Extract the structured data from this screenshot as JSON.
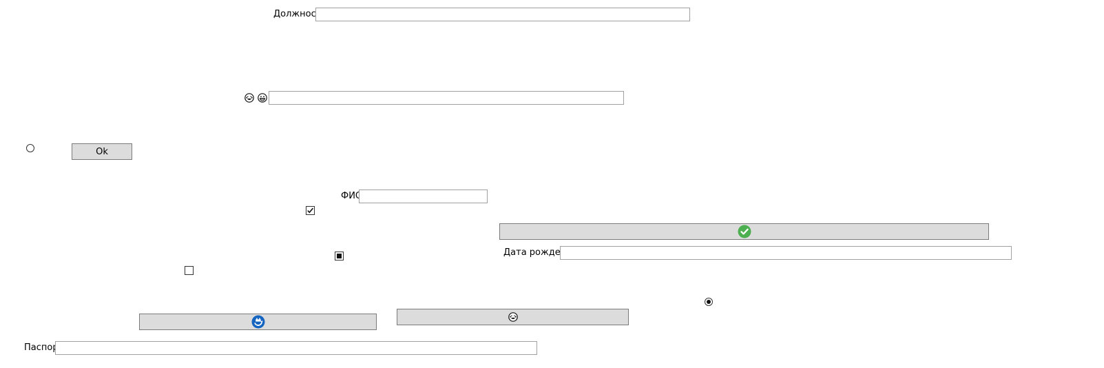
{
  "form": {
    "position_label": "Должность",
    "position_value": "",
    "unnamed_value": "",
    "ok_button_label": "Ok",
    "fio_label": "ФИО",
    "fio_value": "",
    "birth_date_label": "Дата рождения",
    "birth_date_value": "",
    "passport_label": "Паспорт",
    "passport_value": ""
  },
  "controls": {
    "checkbox_checked": true,
    "checkbox_indeterminate": true,
    "checkbox_unchecked": false,
    "radio_top_selected": false,
    "radio_bottom_selected": true
  },
  "icons": {
    "emoji_1": "laughing-face-icon",
    "emoji_2": "grinning-face-icon",
    "green_check": "check-circle-icon",
    "refresh": "refresh-icon",
    "button_emoji": "laughing-face-icon"
  },
  "colors": {
    "button_bg": "#dcdcdc",
    "green_check": "#4caf50",
    "refresh_blue": "#1565c0"
  }
}
